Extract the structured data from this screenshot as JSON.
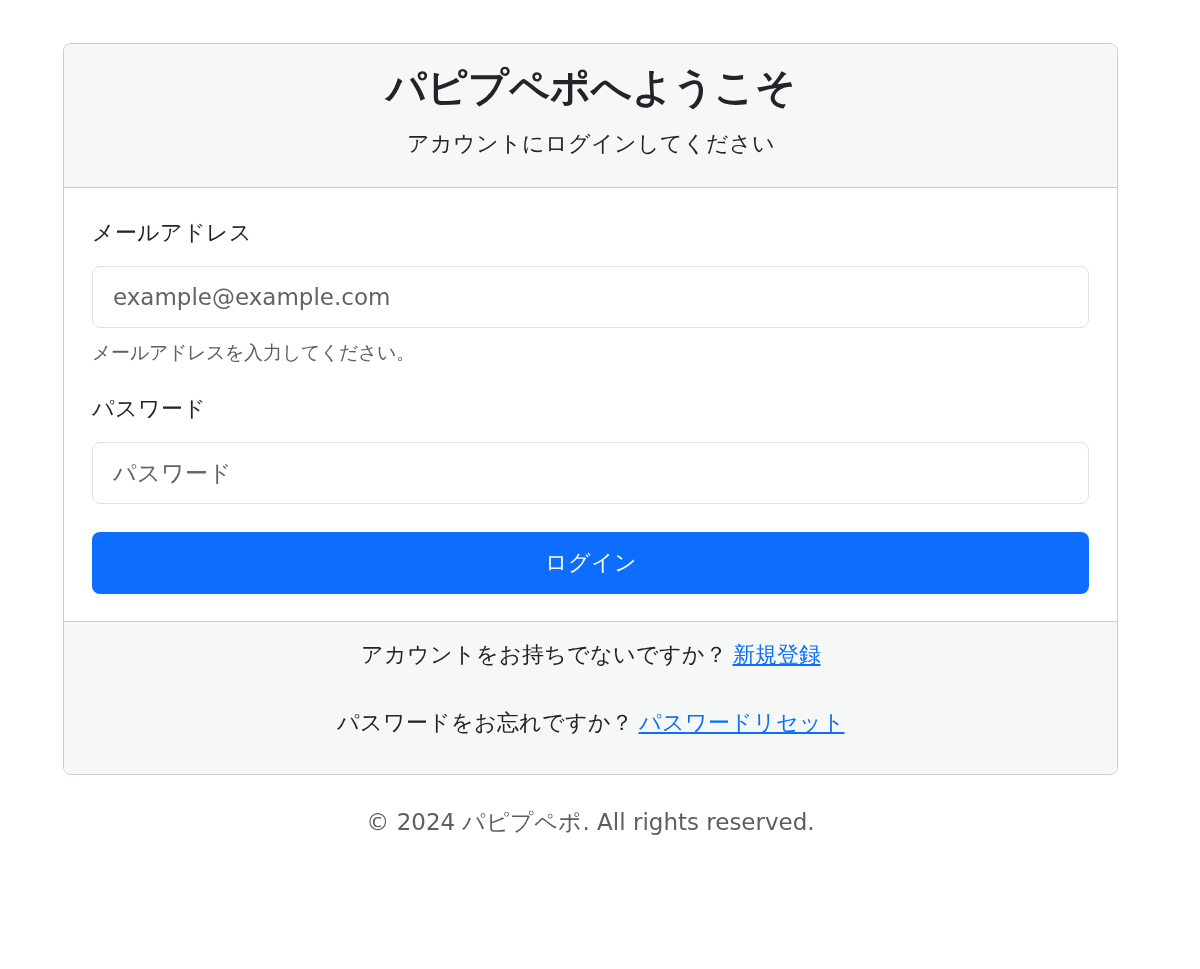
{
  "header": {
    "title": "パピプペポへようこそ",
    "subtitle": "アカウントにログインしてください"
  },
  "fields": [
    {
      "label": "メールアドレス",
      "placeholder": "example@example.com",
      "help": "メールアドレスを入力してください。"
    },
    {
      "label": "パスワード",
      "placeholder": "パスワード"
    }
  ],
  "submit": "ログイン",
  "prompts": [
    {
      "text": "アカウントをお持ちでないですか？",
      "link": "新規登録"
    },
    {
      "text": "パスワードをお忘れですか？",
      "link": "パスワードリセット"
    }
  ],
  "copyright": "© 2024 パピプペポ. All rights reserved."
}
